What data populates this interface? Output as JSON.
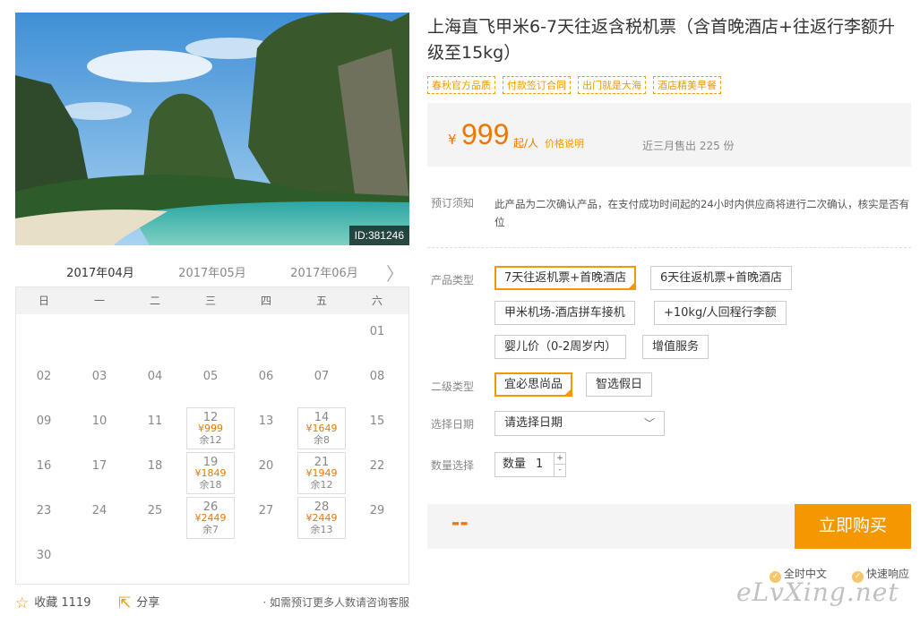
{
  "photo": {
    "id_badge": "ID:381246"
  },
  "calendar": {
    "tabs": [
      "2017年04月",
      "2017年05月",
      "2017年06月"
    ],
    "next_glyph": "〉",
    "weekdays": [
      "日",
      "一",
      "二",
      "三",
      "四",
      "五",
      "六"
    ],
    "weeks": [
      [
        null,
        null,
        null,
        null,
        null,
        null,
        {
          "d": "01"
        }
      ],
      [
        {
          "d": "02"
        },
        {
          "d": "03"
        },
        {
          "d": "04"
        },
        {
          "d": "05"
        },
        {
          "d": "06"
        },
        {
          "d": "07"
        },
        {
          "d": "08"
        }
      ],
      [
        {
          "d": "09"
        },
        {
          "d": "10"
        },
        {
          "d": "11"
        },
        {
          "d": "12",
          "p": "¥999",
          "r": "余12"
        },
        {
          "d": "13"
        },
        {
          "d": "14",
          "p": "¥1649",
          "r": "余8"
        },
        {
          "d": "15"
        }
      ],
      [
        {
          "d": "16"
        },
        {
          "d": "17"
        },
        {
          "d": "18"
        },
        {
          "d": "19",
          "p": "¥1849",
          "r": "余18"
        },
        {
          "d": "20"
        },
        {
          "d": "21",
          "p": "¥1949",
          "r": "余12"
        },
        {
          "d": "22"
        }
      ],
      [
        {
          "d": "23"
        },
        {
          "d": "24"
        },
        {
          "d": "25"
        },
        {
          "d": "26",
          "p": "¥2449",
          "r": "余7"
        },
        {
          "d": "27"
        },
        {
          "d": "28",
          "p": "¥2449",
          "r": "余13"
        },
        {
          "d": "29"
        }
      ],
      [
        {
          "d": "30"
        },
        null,
        null,
        null,
        null,
        null,
        null
      ]
    ]
  },
  "footer_left": {
    "fav_label": "收藏 1119",
    "share_label": "分享",
    "note": "· 如需预订更多人数请咨询客服"
  },
  "product": {
    "title": "上海直飞甲米6-7天往返含税机票（含首晚酒店+往返行李额升级至15kg）",
    "tags": [
      "春秋官方品质",
      "付款签订合同",
      "出门就是大海",
      "酒店精美早餐"
    ],
    "price_yen": "¥",
    "price": "999",
    "price_unit": "起/人",
    "price_explain": "价格说明",
    "sold": "近三月售出 225 份",
    "notice_label": "预订须知",
    "notice_text": "此产品为二次确认产品，在支付成功时间起的24小时内供应商将进行二次确认，核实是否有位"
  },
  "options": {
    "type_label": "产品类型",
    "types": [
      "7天往返机票+首晚酒店",
      "6天往返机票+首晚酒店",
      "甲米机场-酒店拼车接机",
      "+10kg/人回程行李额",
      "婴儿价（0-2周岁内）",
      "增值服务"
    ],
    "subtype_label": "二级类型",
    "subtypes": [
      "宜必思尚品",
      "智选假日"
    ],
    "date_label": "选择日期",
    "date_placeholder": "请选择日期",
    "qty_label": "数量选择",
    "qty_prefix": "数量",
    "qty_value": "1"
  },
  "buy": {
    "total": "--",
    "button": "立即购买",
    "assure1": "全时中文",
    "assure2": "快速响应"
  },
  "watermark": "eLvXing.net",
  "colors": {
    "accent": "#f39800",
    "price": "#ee7700"
  }
}
